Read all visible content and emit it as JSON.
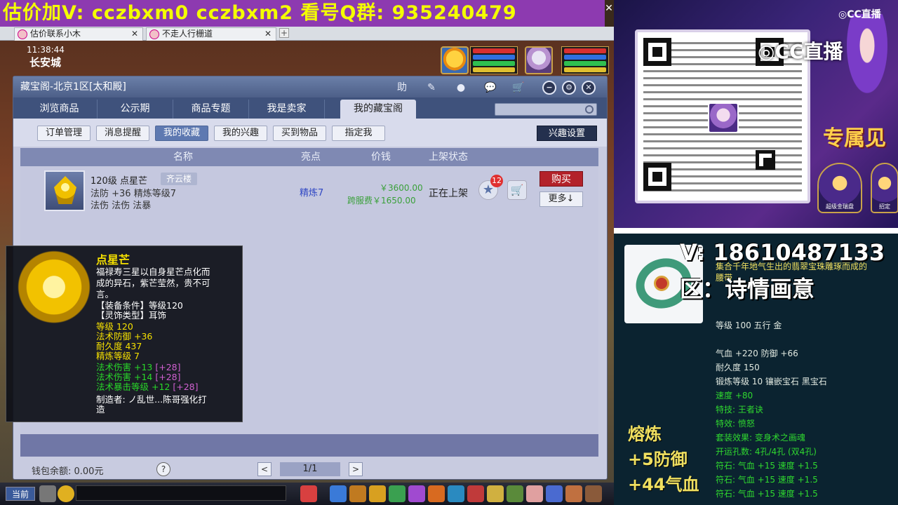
{
  "banner": {
    "text": "估价加V:  cczbxm0  cczbxm2  看号Q群: 935240479",
    "close": "✕"
  },
  "browser_tabs": [
    {
      "label": "估价联系小木",
      "close": "✕"
    },
    {
      "label": "不走人行栅道",
      "close": "✕"
    }
  ],
  "browser_add": "+",
  "hud": {
    "clock": "11:38:44",
    "city": "长安城"
  },
  "window": {
    "title": "藏宝阁-北京1区[太和殿]",
    "title_buttons": [
      "助",
      "✎",
      "●",
      "💬",
      "🛒",
      "−",
      "⚙",
      "✕"
    ],
    "tabs": [
      "浏览商品",
      "公示期",
      "商品专题",
      "我是卖家",
      "我的藏宝阁"
    ],
    "sub_buttons": [
      "订单管理",
      "消息提醒",
      "我的收藏",
      "我的兴趣",
      "买到物品",
      "指定我"
    ],
    "interest_settings": "兴趣设置",
    "columns": [
      "名称",
      "亮点",
      "价钱",
      "上架状态"
    ],
    "item": {
      "name": "120级 点星芒",
      "tag": "齐云楼",
      "stat1": "法防 +36 精炼等级7",
      "stat2": "法伤 法伤 法暴",
      "highlight": "精炼7",
      "price": "￥3600.00",
      "cross_price": "跨服费￥1650.00",
      "status": "正在上架",
      "star": "★",
      "star_count": "12",
      "cart": "🛒",
      "buy": "购买",
      "more": "更多↓"
    },
    "wallet": "钱包余额: 0.00元",
    "help": "?",
    "prev": "<",
    "page": "1/1",
    "next": ">"
  },
  "tooltip": {
    "title": "点星芒",
    "desc1": "福禄寿三星以自身星芒点化而",
    "desc2": "成的异石，紫芒莹然，贵不可",
    "desc3": "言。",
    "req1": "【装备条件】等级120",
    "req2": "【灵饰类型】耳饰",
    "level": "等级 120",
    "mdef": "法术防御 +36",
    "durability": "耐久度 437",
    "refine": "精炼等级 7",
    "m1": "法术伤害 +13",
    "m1p": "[+28]",
    "m2": "法术伤害 +14",
    "m2p": "[+28]",
    "m3": "法术暴击等级 +12",
    "m3p": "[+28]",
    "maker1": "制造者: ノ乱世...陈哥强化打",
    "maker2": "造"
  },
  "game_bar": {
    "current": "当前"
  },
  "stream": {
    "cc_logo": "◎CC直播",
    "cc_big": "◎CC直播",
    "zhuanshu": "专属见",
    "promo_buttons": [
      "超级金瑞盘",
      "招定"
    ],
    "vline": "V: 18610487133",
    "zone": "区：诗情画意",
    "desc1": "集合千年地气生出的翡翠宝珠雕琢而成的",
    "desc2": "腰带",
    "stats": [
      "等级 100  五行 金",
      "气血 +220  防御 +66",
      "耐久度 150",
      "锻炼等级 10  镶嵌宝石 黑宝石",
      "速度 +80",
      "特技: 王者诀",
      "特效: 愤怒",
      "套装效果: 变身术之画魂",
      "开运孔数: 4孔/4孔 (双4孔)",
      "符石: 气血 +15 速度 +1.5",
      "符石: 气血 +15 速度 +1.5",
      "符石: 气血 +15 速度 +1.5"
    ],
    "melt_title": "熔炼",
    "melt1": "+5防御",
    "melt2": "+44气血"
  },
  "colors": {
    "banner_bg": "#8d3ab0",
    "banner_text": "#f4ff00",
    "buy_red": "#b3222a",
    "tab_blue": "#3f527c"
  }
}
